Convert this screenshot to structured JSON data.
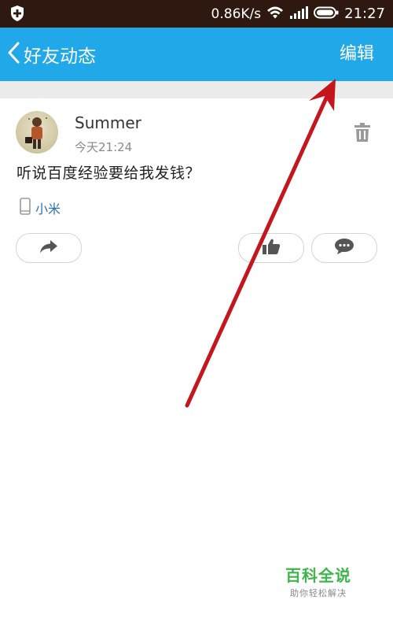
{
  "status_bar": {
    "net_speed": "0.86K/s",
    "time": "21:27",
    "icons": [
      "shield-plus-icon",
      "wifi-icon",
      "signal-icon",
      "battery-icon"
    ]
  },
  "header": {
    "title": "好友动态",
    "edit_label": "编辑",
    "color": "#20a8e8"
  },
  "post": {
    "author": "Summer",
    "time": "今天21:24",
    "text": "听说百度经验要给我发钱？",
    "device": "小米",
    "actions": [
      "share-icon",
      "thumbs-up-icon",
      "comment-icon"
    ]
  },
  "watermark": {
    "title": "百科全说",
    "subtitle": "助你轻松解决"
  },
  "annotation": {
    "arrow_color": "#c4161c"
  }
}
